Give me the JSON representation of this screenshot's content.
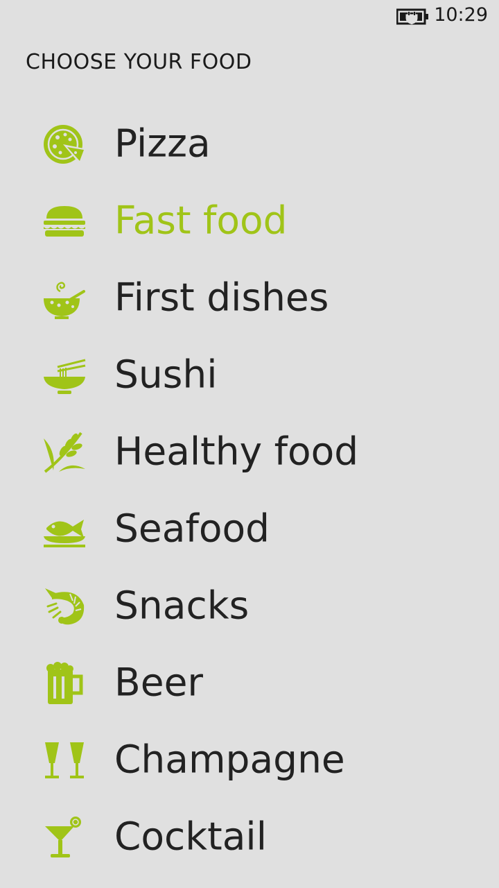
{
  "status_bar": {
    "time": "10:29",
    "battery_icon": "battery-charging-icon"
  },
  "page_title": "CHOOSE YOUR FOOD",
  "accent_color": "#a0c418",
  "text_color": "#222222",
  "background_color": "#e0e0e0",
  "menu": {
    "selected_index": 1,
    "items": [
      {
        "label": "Pizza",
        "icon": "pizza-icon"
      },
      {
        "label": "Fast food",
        "icon": "burger-icon"
      },
      {
        "label": "First dishes",
        "icon": "soup-bowl-icon"
      },
      {
        "label": "Sushi",
        "icon": "noodle-bowl-icon"
      },
      {
        "label": "Healthy food",
        "icon": "wheat-icon"
      },
      {
        "label": "Seafood",
        "icon": "fish-plate-icon"
      },
      {
        "label": "Snacks",
        "icon": "shrimp-icon"
      },
      {
        "label": "Beer",
        "icon": "beer-mug-icon"
      },
      {
        "label": "Champagne",
        "icon": "champagne-glasses-icon"
      },
      {
        "label": "Cocktail",
        "icon": "cocktail-icon"
      }
    ]
  }
}
